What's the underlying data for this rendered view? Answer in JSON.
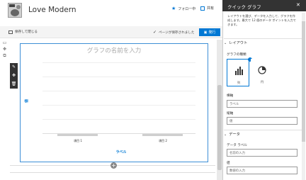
{
  "site": {
    "title": "Love Modern",
    "follow_label": "フォロー中",
    "share_label": "共有"
  },
  "command_bar": {
    "save_close_label": "保存して閉じる",
    "saved_message": "ページが保存されました",
    "publish_label": "発行"
  },
  "chart_data": {
    "type": "bar",
    "title": "グラフの名前を入力",
    "categories": [
      "項目 1",
      "項目 2"
    ],
    "values": [
      0,
      0
    ],
    "xlabel": "ラベル",
    "ylabel": "値",
    "grid": true
  },
  "panel": {
    "title": "クイック グラフ",
    "description": "レイアウトを選び、データを入力して、グラフを作成します。最大で 12 個のデータ ポイントを入力できます。",
    "layout_section": "レイアウト",
    "chart_type_label": "グラフの種類",
    "types": [
      {
        "caption": "列",
        "icon": "bar-chart-icon",
        "selected": true
      },
      {
        "caption": "円",
        "icon": "pie-chart-icon",
        "selected": false
      }
    ],
    "horizontal_axis_label": "横軸",
    "horizontal_axis_value": "ラベル",
    "vertical_axis_label": "縦軸",
    "vertical_axis_value": "値",
    "data_section": "データ",
    "data_label_label": "データ ラベル",
    "data_label_placeholder": "名前の入力",
    "value_label": "値",
    "value_placeholder": "数値の入力"
  },
  "colors": {
    "accent": "#0078d4",
    "panel_header": "#333333"
  }
}
